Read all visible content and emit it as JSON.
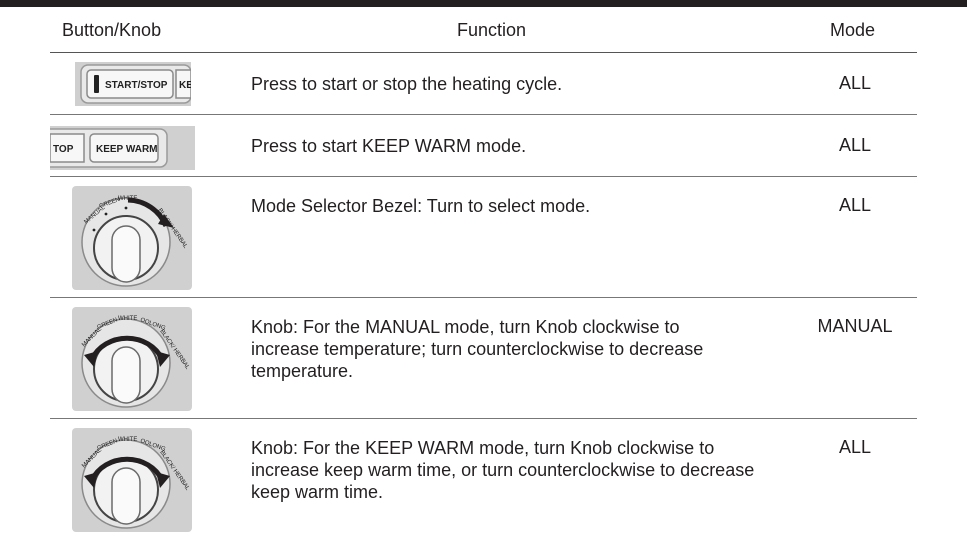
{
  "table": {
    "headers": {
      "button": "Button/Knob",
      "function": "Function",
      "mode": "Mode"
    },
    "rows": [
      {
        "image": {
          "type": "button-strip",
          "primary": "START/STOP",
          "secondary": "KEI",
          "led": true
        },
        "function": "Press to start or stop the heating cycle.",
        "mode": "ALL"
      },
      {
        "image": {
          "type": "button-strip",
          "primary": "KEEP WARM",
          "secondary": "TOP",
          "led": false
        },
        "function": "Press to start KEEP WARM mode.",
        "mode": "ALL"
      },
      {
        "image": {
          "type": "knob",
          "arrow": "bezel-clockwise",
          "labels": [
            "MANUAL",
            "GREEN",
            "WHITE",
            "BLACK/ HERBAL"
          ]
        },
        "function": "Mode Selector Bezel: Turn to select mode.",
        "mode": "ALL"
      },
      {
        "image": {
          "type": "knob",
          "arrow": "two-way",
          "labels": [
            "MANUAL",
            "GREEN",
            "WHITE",
            "OOLONG",
            "BLACK/ HERBAL"
          ]
        },
        "function": "Knob: For the MANUAL mode, turn Knob clockwise to increase temperature; turn counterclockwise to decrease temperature.",
        "mode": "MANUAL"
      },
      {
        "image": {
          "type": "knob",
          "arrow": "two-way",
          "labels": [
            "MANUAL",
            "GREEN",
            "WHITE",
            "OOLONG",
            "BLACK/ HERBAL"
          ]
        },
        "function": "Knob: For the KEEP WARM mode, turn Knob clockwise to increase keep warm time, or turn counterclockwise to decrease keep warm time.",
        "mode": "ALL"
      }
    ]
  },
  "colors": {
    "rule": "#777777",
    "bar": "#231f20",
    "panel": "#c9c9c9",
    "arrow": "#231f20"
  }
}
